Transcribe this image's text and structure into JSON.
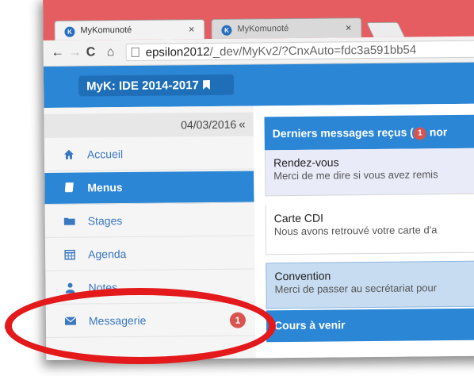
{
  "browser": {
    "tabs": [
      {
        "title": "MyKomunoté",
        "favicon": "K",
        "active": true
      },
      {
        "title": "MyKomunoté",
        "favicon": "K",
        "active": false
      }
    ],
    "close_glyph": "×",
    "url_main": "epsilon2012",
    "url_rest": "/_dev/MyKv2/?CnxAuto=fdc3a591bb54",
    "nav_icons": {
      "back": "←",
      "forward": "→",
      "reload": "C",
      "home": "⌂"
    }
  },
  "app": {
    "brand": "MyK: IDE 2014-2017",
    "date": "04/03/2016",
    "collapse_glyph": "«",
    "colors": {
      "primary": "#2b86d6",
      "badge": "#d9534f",
      "highlight": "#e3191b"
    }
  },
  "menu": [
    {
      "label": "Accueil",
      "icon": "home-icon"
    },
    {
      "label": "Menus",
      "icon": "book-icon"
    },
    {
      "label": "Stages",
      "icon": "folder-icon"
    },
    {
      "label": "Agenda",
      "icon": "calendar-icon"
    },
    {
      "label": "Notes",
      "icon": "user-icon"
    },
    {
      "label": "Messagerie",
      "icon": "envelope-icon",
      "badge": "1"
    }
  ],
  "messages_panel": {
    "title_prefix": "Derniers messages reçus (",
    "count": "1",
    "title_suffix": " nor",
    "items": [
      {
        "subject": "Rendez-vous",
        "preview": "Merci de me dire si vous avez remis"
      },
      {
        "subject": "Carte CDI",
        "preview": "Nous avons retrouvé votre carte d'a"
      },
      {
        "subject": "Convention",
        "preview": "Merci de passer au secrétariat pour"
      }
    ]
  },
  "courses_panel": {
    "title": "Cours à venir"
  }
}
